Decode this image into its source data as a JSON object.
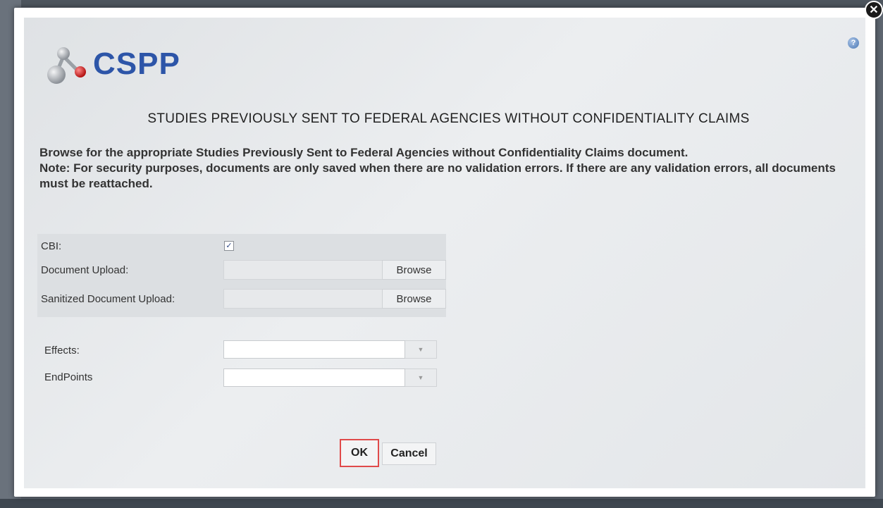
{
  "dialog": {
    "brand": "CSPP",
    "close_icon": "close-icon",
    "help_icon": "help-icon",
    "heading": "STUDIES PREVIOUSLY SENT TO FEDERAL AGENCIES WITHOUT CONFIDENTIALITY CLAIMS",
    "instruction_line1": "Browse for the appropriate Studies Previously Sent to Federal Agencies without Confidentiality Claims document.",
    "instruction_line2": "Note: For security purposes, documents are only saved when there are no validation errors. If there are any validation errors, all documents must be reattached."
  },
  "form": {
    "cbi_label": "CBI:",
    "cbi_checked": true,
    "cbi_check_glyph": "✓",
    "document_upload_label": "Document Upload:",
    "document_upload_value": "",
    "sanitized_upload_label": "Sanitized Document Upload:",
    "sanitized_upload_value": "",
    "browse_label": "Browse",
    "effects_label": "Effects:",
    "effects_value": "",
    "endpoints_label": "EndPoints",
    "endpoints_value": ""
  },
  "buttons": {
    "ok_label": "OK",
    "cancel_label": "Cancel"
  },
  "colors": {
    "brand": "#2d55a8",
    "ok_highlight": "#e04a4a"
  }
}
